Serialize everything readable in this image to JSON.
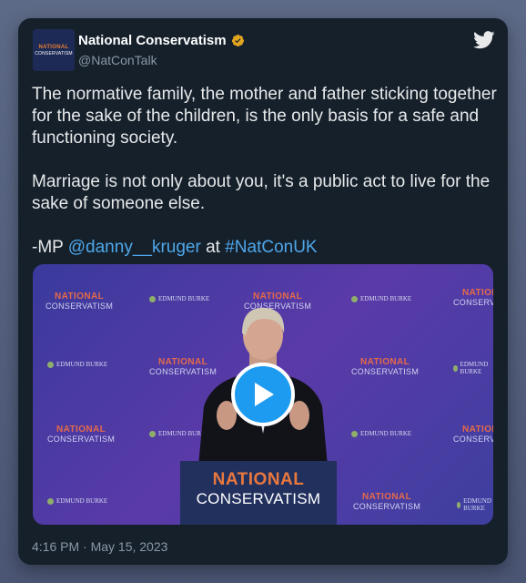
{
  "account": {
    "name": "National Conservatism",
    "handle": "@NatConTalk",
    "avatar_line1": "NATIONAL",
    "avatar_line2": "CONSERVATISM",
    "verified_color": "#e2a520"
  },
  "tweet": {
    "paragraph1": "The normative family, the mother and father sticking together for the sake of the children, is the only basis for a safe and functioning society.",
    "paragraph2": "Marriage is not only about you, it's a public act to live for the sake of someone else.",
    "p3_prefix": "-MP ",
    "mention": "@danny__kruger",
    "p3_middle": " at ",
    "hashtag": "#NatConUK",
    "timestamp": "4:16 PM · May 15, 2023"
  },
  "media": {
    "backdrop_line1": "NATIONAL",
    "backdrop_line2": "CONSERVATISM",
    "burke_label": "EDMUND BURKE",
    "podium_line1": "NATIONAL",
    "podium_line2": "CONSERVATISM",
    "play_icon": "play-icon"
  },
  "colors": {
    "card_bg": "#15202b",
    "link": "#4fa7ea",
    "play": "#1d9bf0",
    "accent_orange": "#e87d2f"
  }
}
